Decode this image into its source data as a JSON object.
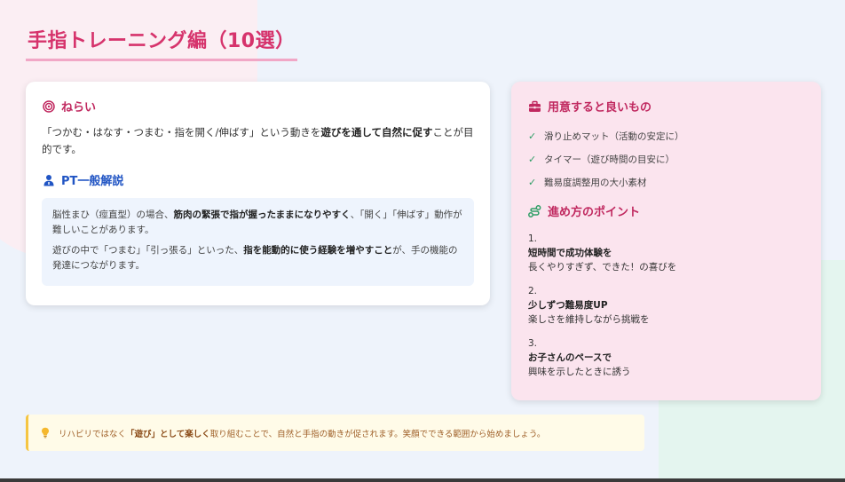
{
  "title": "手指トレーニング編（10選）",
  "aim": {
    "heading": "ねらい",
    "text_1": "「つかむ・はなす・つまむ・指を開く/伸ばす」という動きを",
    "text_bold": "遊びを通して自然に促す",
    "text_2": "ことが目的です。"
  },
  "pt": {
    "heading": "PT一般解説",
    "p1_a": "脳性まひ（痙直型）の場合、",
    "p1_bold": "筋肉の緊張で指が握ったままになりやすく",
    "p1_b": "、「開く」「伸ばす」動作が難しいことがあります。",
    "p2_a": "遊びの中で「つまむ」「引っ張る」といった、",
    "p2_bold": "指を能動的に使う経験を増やすこと",
    "p2_b": "が、手の機能の発達につながります。"
  },
  "supplies": {
    "heading": "用意すると良いもの",
    "items": [
      "滑り止めマット（活動の安定に）",
      "タイマー（遊び時間の目安に）",
      "難易度調整用の大小素材"
    ]
  },
  "points": {
    "heading": "進め方のポイント",
    "steps": [
      {
        "num": "1.",
        "title": "短時間で成功体験を",
        "desc": "長くやりすぎず、できた！の喜びを"
      },
      {
        "num": "2.",
        "title": "少しずつ難易度UP",
        "desc": "楽しさを維持しながら挑戦を"
      },
      {
        "num": "3.",
        "title": "お子さんのペースで",
        "desc": "興味を示したときに誘う"
      }
    ]
  },
  "note": {
    "text_1": "リハビリではなく",
    "text_bold": "「遊び」として楽しく",
    "text_2": "取り組むことで、自然と手指の動きが促されます。笑顔でできる範囲から始めましょう。"
  },
  "colors": {
    "accent_pink": "#d6336c",
    "accent_blue": "#2155c4",
    "check_green": "#2f9e66",
    "note_yellow": "#f5c542"
  }
}
